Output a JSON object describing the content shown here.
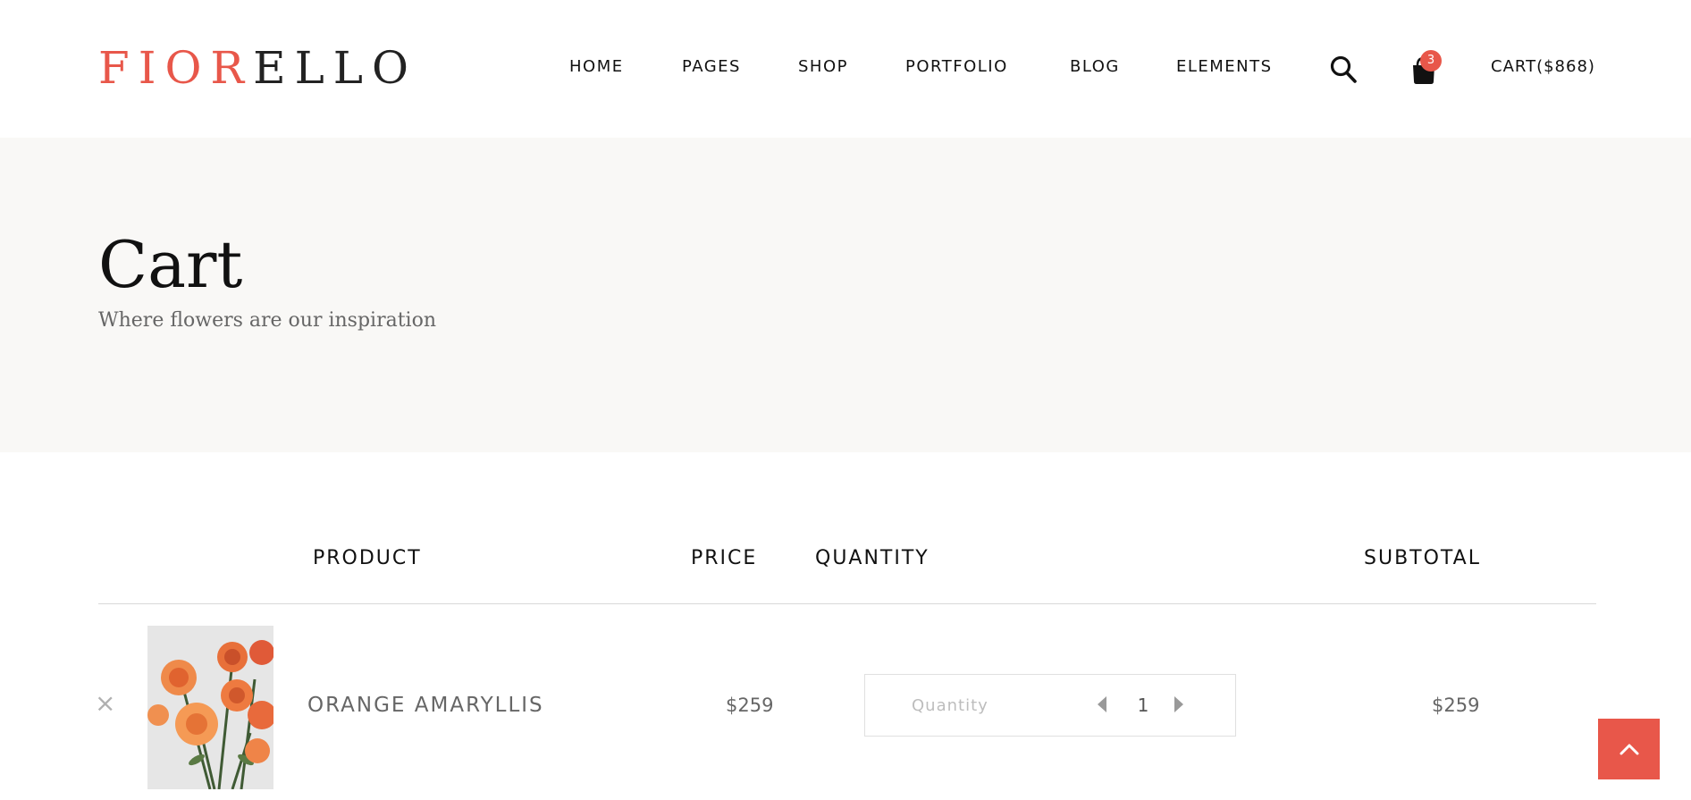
{
  "header": {
    "logo_part1": "FIOR",
    "logo_part2": "ELLO",
    "nav": [
      {
        "label": "HOME"
      },
      {
        "label": "PAGES"
      },
      {
        "label": "SHOP"
      },
      {
        "label": "PORTFOLIO"
      },
      {
        "label": "BLOG"
      },
      {
        "label": "ELEMENTS"
      }
    ],
    "search_icon": "search-icon",
    "bag_icon": "shopping-bag-icon",
    "cart_count": "3",
    "cart_label": "CART($868)"
  },
  "hero": {
    "title": "Cart",
    "subtitle": "Where flowers are our inspiration"
  },
  "table": {
    "headers": {
      "product": "PRODUCT",
      "price": "PRICE",
      "quantity": "QUANTITY",
      "subtotal": "SUBTOTAL"
    },
    "rows": [
      {
        "remove": "×",
        "name": "ORANGE AMARYLLIS",
        "price": "$259",
        "quantity_label": "Quantity",
        "quantity": "1",
        "subtotal": "$259"
      }
    ]
  },
  "colors": {
    "accent": "#e8574a",
    "hero_bg": "#f9f8f6"
  },
  "scroll_top_icon": "chevron-up-icon"
}
